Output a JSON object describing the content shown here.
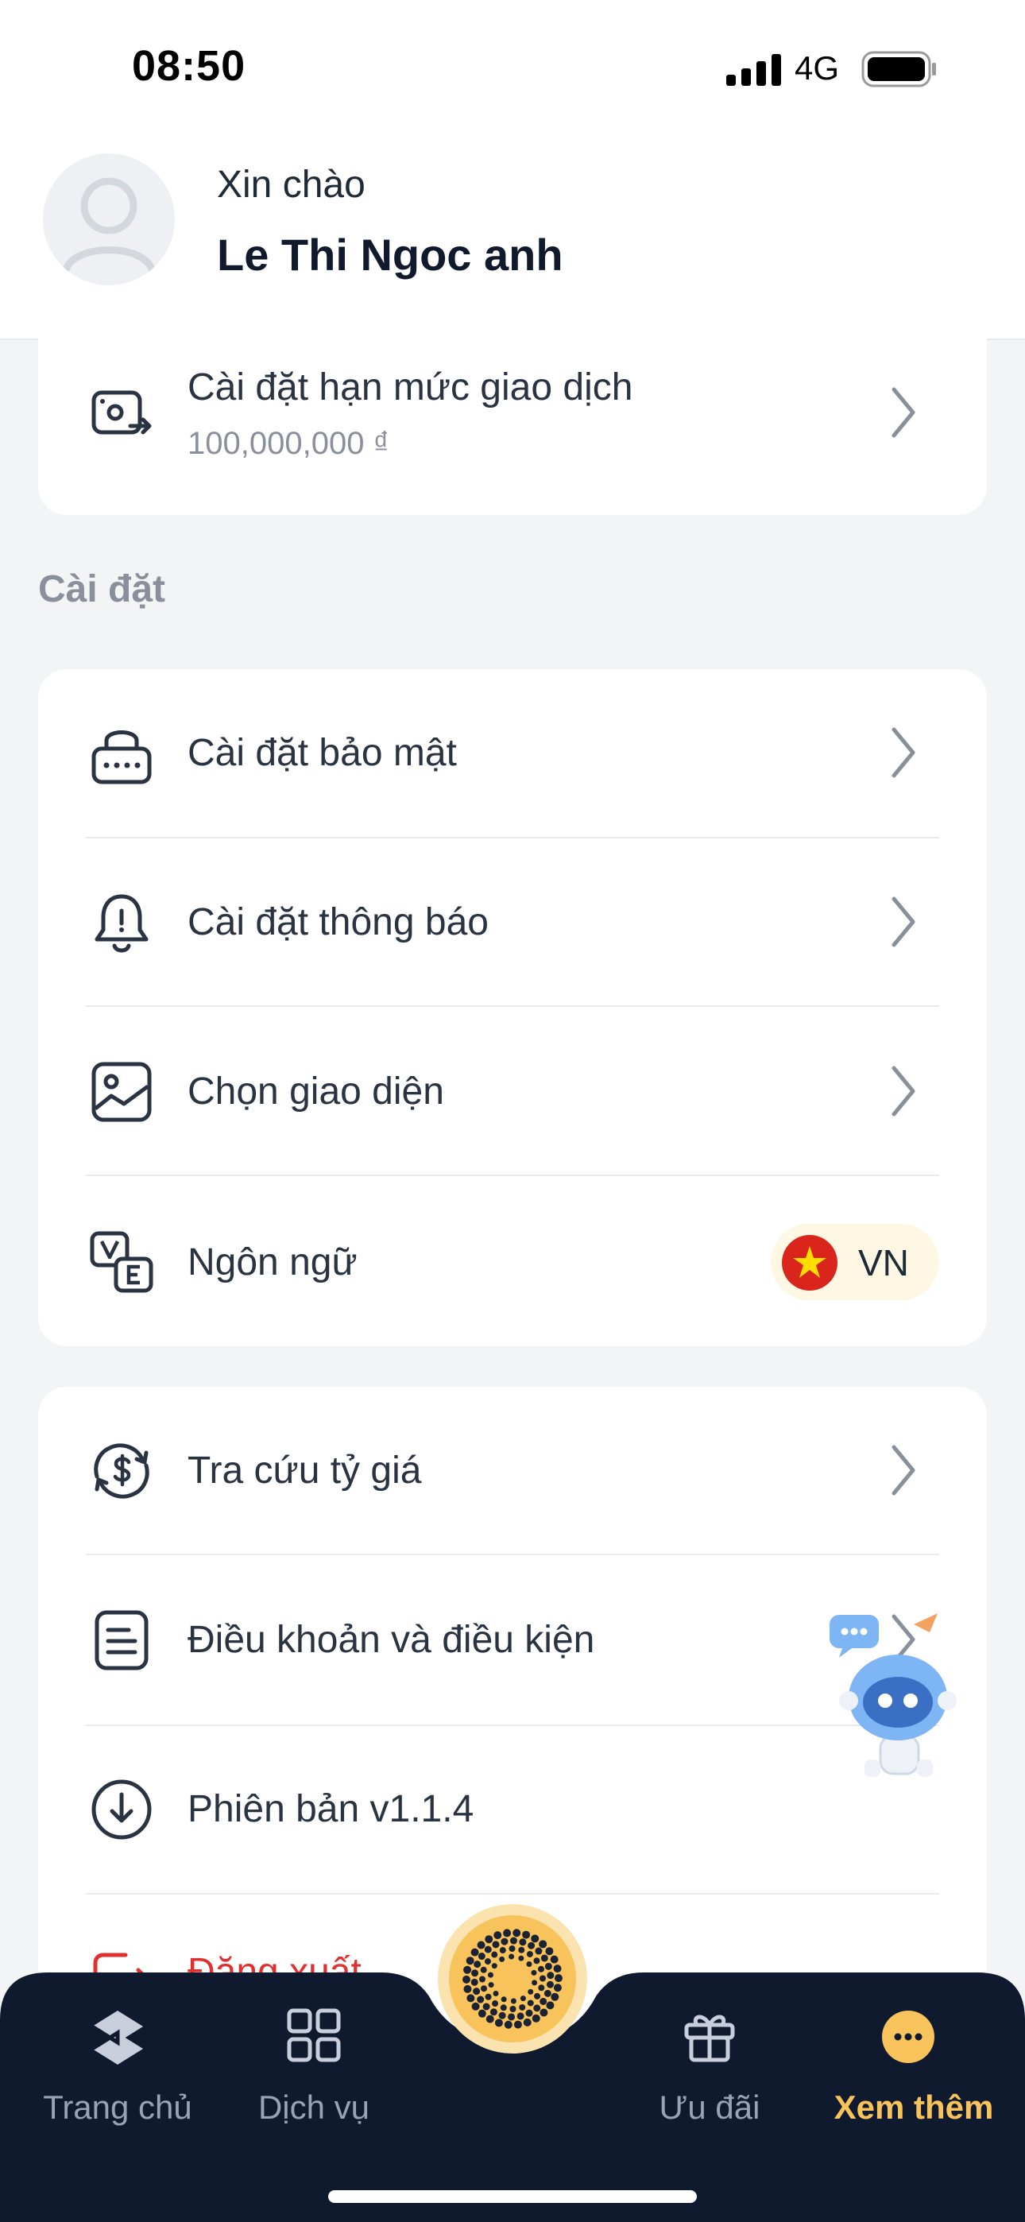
{
  "status_bar": {
    "time": "08:50",
    "network": "4G"
  },
  "header": {
    "greeting": "Xin chào",
    "user_name": "Le Thi Ngoc anh"
  },
  "limit_card": {
    "label": "Cài đặt hạn mức giao dịch",
    "value": "100,000,000 ₫"
  },
  "settings_section": {
    "title": "Cài đặt",
    "items": [
      {
        "label": "Cài đặt bảo mật",
        "icon": "lock-icon"
      },
      {
        "label": "Cài đặt thông báo",
        "icon": "bell-icon"
      },
      {
        "label": "Chọn giao diện",
        "icon": "image-icon"
      },
      {
        "label": "Ngôn ngữ",
        "icon": "language-icon",
        "value": "VN"
      }
    ]
  },
  "more_section": {
    "items": [
      {
        "label": "Tra cứu tỷ giá",
        "icon": "exchange-rate-icon"
      },
      {
        "label": "Điều khoản và điều kiện",
        "icon": "document-icon"
      },
      {
        "label": "Phiên bản v1.1.4",
        "icon": "download-icon"
      },
      {
        "label": "Đăng xuất",
        "icon": "logout-icon"
      }
    ]
  },
  "bottom_nav": {
    "items": [
      {
        "label": "Trang chủ",
        "icon": "home-icon",
        "active": false
      },
      {
        "label": "Dịch vụ",
        "icon": "grid-icon",
        "active": false
      },
      {
        "label": "Ưu đãi",
        "icon": "gift-icon",
        "active": false
      },
      {
        "label": "Xem thêm",
        "icon": "more-icon",
        "active": true
      }
    ]
  },
  "colors": {
    "accent": "#f7c35a",
    "nav_background": "#101a2e",
    "page_background": "#f3f4f6",
    "logout_red": "#e03131",
    "language_pill": "#fdf7e4"
  }
}
